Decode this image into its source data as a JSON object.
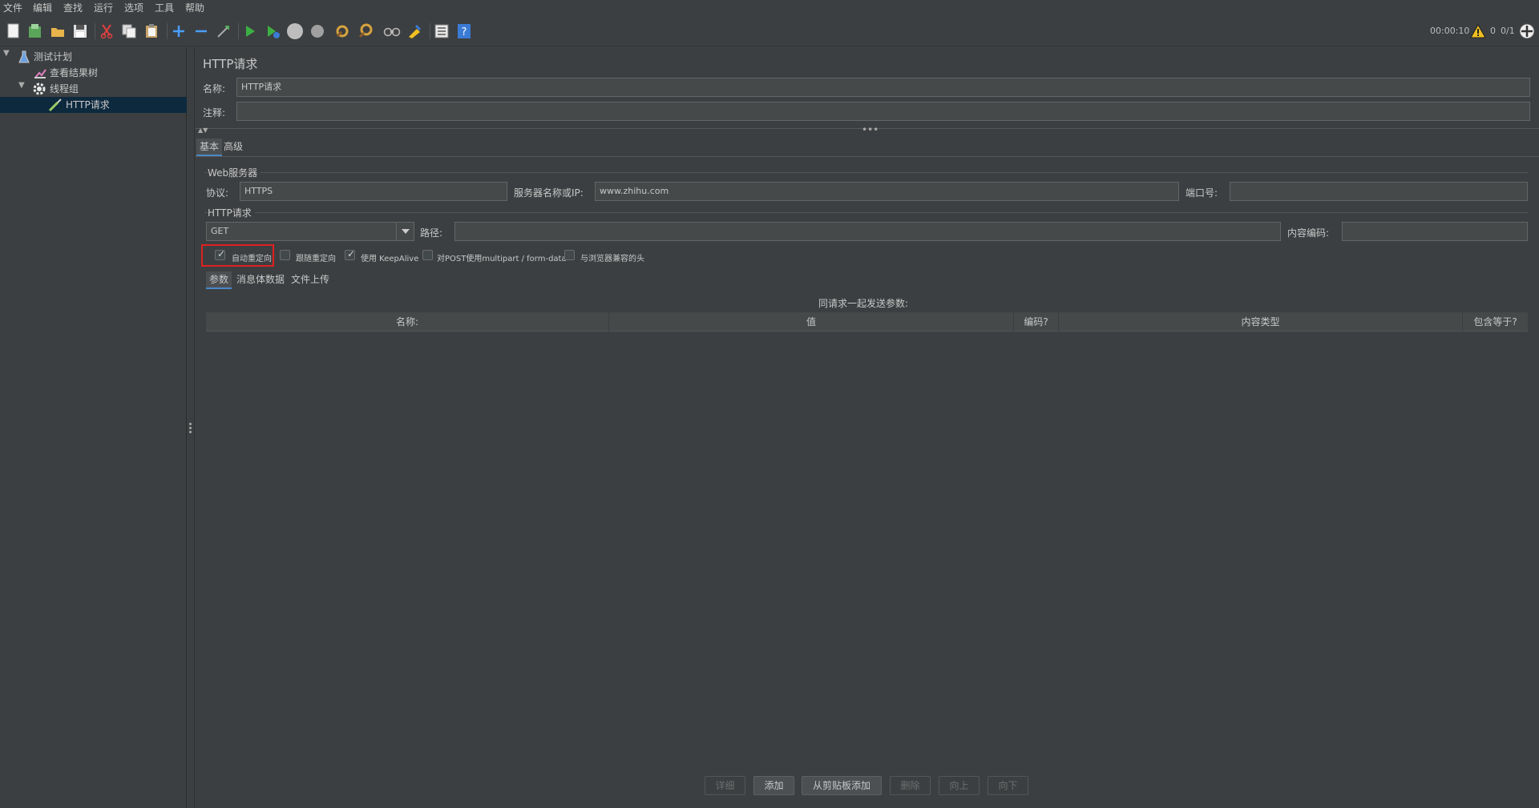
{
  "menu": [
    "文件",
    "编辑",
    "查找",
    "运行",
    "选项",
    "工具",
    "帮助"
  ],
  "status": {
    "timer": "00:00:10",
    "warnings": "0",
    "threads": "0/1"
  },
  "tree": {
    "items": [
      {
        "label": "测试计划"
      },
      {
        "label": "查看结果树"
      },
      {
        "label": "线程组"
      },
      {
        "label": "HTTP请求"
      }
    ]
  },
  "panel": {
    "title": "HTTP请求",
    "name_label": "名称:",
    "name_value": "HTTP请求",
    "comment_label": "注释:",
    "comment_value": ""
  },
  "tabs": [
    "基本",
    "高级"
  ],
  "web_server": {
    "title": "Web服务器",
    "protocol_label": "协议:",
    "protocol_value": "HTTPS",
    "server_label": "服务器名称或IP:",
    "server_value": "www.zhihu.com",
    "port_label": "端口号:",
    "port_value": ""
  },
  "http_request": {
    "title": "HTTP请求",
    "method_value": "GET",
    "path_label": "路径:",
    "path_value": "",
    "encoding_label": "内容编码:",
    "encoding_value": ""
  },
  "options": [
    {
      "label": "自动重定向",
      "checked": true
    },
    {
      "label": "跟随重定向",
      "checked": false
    },
    {
      "label": "使用 KeepAlive",
      "checked": true
    },
    {
      "label": "对POST使用multipart / form-data",
      "checked": false
    },
    {
      "label": "与浏览器兼容的头",
      "checked": false
    }
  ],
  "sub_tabs": [
    "参数",
    "消息体数据",
    "文件上传"
  ],
  "params": {
    "caption": "同请求一起发送参数:",
    "columns": [
      "名称:",
      "值",
      "编码?",
      "内容类型",
      "包含等于?"
    ]
  },
  "buttons": [
    {
      "label": "详细",
      "enabled": false
    },
    {
      "label": "添加",
      "enabled": true
    },
    {
      "label": "从剪贴板添加",
      "enabled": true
    },
    {
      "label": "删除",
      "enabled": false
    },
    {
      "label": "向上",
      "enabled": false
    },
    {
      "label": "向下",
      "enabled": false
    }
  ],
  "colors": {
    "background": "#3c3f41",
    "selection": "#0d293e",
    "highlight": "#e02020",
    "accent": "#4a88c7"
  }
}
